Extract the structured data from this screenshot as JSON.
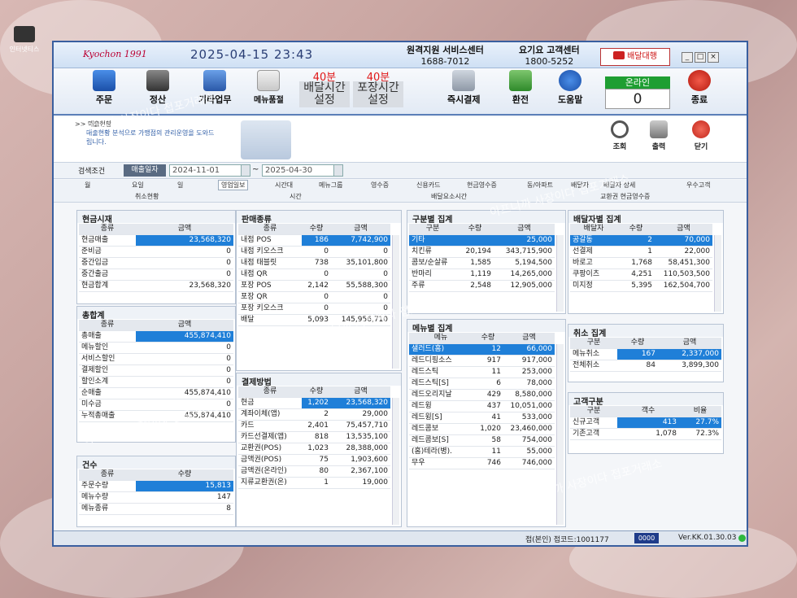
{
  "desktop": {
    "icon_label": "인터넷티스"
  },
  "header": {
    "logo": "Kyochon 1991",
    "datetime": "2025-04-15 23:43",
    "remote_support": {
      "label": "원격지원 서비스센터",
      "phone": "1688-7012"
    },
    "yogiyo": {
      "label": "요기요 고객센터",
      "phone": "1800-5252"
    },
    "delivery_button": "배달대행",
    "window_buttons": [
      "_",
      "□",
      "×"
    ]
  },
  "toolbar": {
    "order": "주문",
    "settlement": "정산",
    "other_work": "기타업무",
    "menu_soldout": "메뉴품절",
    "delivery_time": {
      "minutes": "40분",
      "label": "배달시간 설정"
    },
    "pack_time": {
      "minutes": "40분",
      "label": "포장시간 설정"
    },
    "instant_pay": "즉시결제",
    "exchange": "환전",
    "help": "도움말",
    "online": {
      "label": "온라인",
      "value": "0"
    },
    "exit": "종료"
  },
  "report": {
    "crumb": ">> 매출현황",
    "desc": "매출현황 분석으로 가맹점의 관리운영을 도와드립니다.",
    "view": "조회",
    "print": "출력",
    "close": "닫기"
  },
  "search": {
    "label": "검색조건",
    "date_type": "매출일자",
    "from": "2024-11-01",
    "tilde": "~",
    "to": "2025-04-30"
  },
  "tabs_row1": [
    "월",
    "요일",
    "일",
    "영업일보",
    "시간대",
    "메뉴그룹",
    "영수증",
    "신용카드",
    "현금영수증",
    "동/아파트",
    "배달자",
    "배달자 상세",
    "우수고객"
  ],
  "tabs_row2": [
    "취소현황",
    "시간",
    "배달요소시간",
    "교환권 현금영수증"
  ],
  "panels": {
    "cash": {
      "title": "현금시재",
      "headers": [
        "종류",
        "금액"
      ],
      "rows": [
        [
          "현금매출",
          "23,568,320"
        ],
        [
          "준비금",
          "0"
        ],
        [
          "중간입금",
          "0"
        ],
        [
          "중간출금",
          "0"
        ],
        [
          "현금합계",
          "23,568,320"
        ]
      ]
    },
    "total": {
      "title": "총합계",
      "headers": [
        "종류",
        "금액"
      ],
      "rows": [
        [
          "총매출",
          "455,874,410"
        ],
        [
          "메뉴할인",
          "0"
        ],
        [
          "서비스할인",
          "0"
        ],
        [
          "결제할인",
          "0"
        ],
        [
          "할인소계",
          "0"
        ],
        [
          "순매출",
          "455,874,410"
        ],
        [
          "미수금",
          "0"
        ],
        [
          "누적총매출",
          "455,874,410"
        ]
      ]
    },
    "count": {
      "title": "건수",
      "headers": [
        "종류",
        "수량"
      ],
      "rows": [
        [
          "주문수량",
          "15,813"
        ],
        [
          "메뉴수량",
          "147"
        ],
        [
          "메뉴종류",
          "8"
        ]
      ]
    },
    "sales_type": {
      "title": "판매종류",
      "headers": [
        "종류",
        "수량",
        "금액"
      ],
      "rows": [
        [
          "내점 POS",
          "186",
          "7,742,900"
        ],
        [
          "내점 키오스크",
          "0",
          "0"
        ],
        [
          "내점 태블릿",
          "738",
          "35,101,800"
        ],
        [
          "내점 QR",
          "0",
          "0"
        ],
        [
          "포장 POS",
          "2,142",
          "55,588,300"
        ],
        [
          "포장 QR",
          "0",
          "0"
        ],
        [
          "포장 키오스크",
          "0",
          "0"
        ],
        [
          "배달",
          "5,093",
          "145,956,710"
        ]
      ]
    },
    "payment": {
      "title": "결제방법",
      "headers": [
        "종류",
        "수량",
        "금액"
      ],
      "rows": [
        [
          "현금",
          "1,202",
          "23,568,320"
        ],
        [
          "계좌이체(앱)",
          "2",
          "29,000"
        ],
        [
          "카드",
          "2,401",
          "75,457,710"
        ],
        [
          "카드선결제(앱)",
          "818",
          "13,535,100"
        ],
        [
          "교환권(POS)",
          "1,023",
          "28,388,000"
        ],
        [
          "금액권(POS)",
          "75",
          "1,903,600"
        ],
        [
          "금액권(온라인)",
          "80",
          "2,367,100"
        ],
        [
          "지류교환권(온)",
          "1",
          "19,000"
        ]
      ]
    },
    "category": {
      "title": "구분별 집계",
      "headers": [
        "구분",
        "수량",
        "금액"
      ],
      "rows": [
        [
          "기타",
          "",
          "25,000"
        ],
        [
          "치킨류",
          "20,194",
          "343,715,900"
        ],
        [
          "콤보/순살류",
          "1,585",
          "5,194,500"
        ],
        [
          "반마리",
          "1,119",
          "14,265,000"
        ],
        [
          "주류",
          "2,548",
          "12,905,000"
        ]
      ]
    },
    "menu": {
      "title": "메뉴별 집계",
      "headers": [
        "메뉴",
        "수량",
        "금액"
      ],
      "rows": [
        [
          "샐러드(홈)",
          "12",
          "66,000"
        ],
        [
          "레드디핑소스",
          "917",
          "917,000"
        ],
        [
          "레드스틱",
          "11",
          "253,000"
        ],
        [
          "레드스틱[S]",
          "6",
          "78,000"
        ],
        [
          "레드오리지날",
          "429",
          "8,580,000"
        ],
        [
          "레드윙",
          "437",
          "10,051,000"
        ],
        [
          "레드윙[S]",
          "41",
          "533,000"
        ],
        [
          "레드콤보",
          "1,020",
          "23,460,000"
        ],
        [
          "레드콤보[S]",
          "58",
          "754,000"
        ],
        [
          "(홈)테라(병).",
          "11",
          "55,000"
        ],
        [
          "무우",
          "746",
          "746,000"
        ]
      ]
    },
    "driver": {
      "title": "배달자별 집계",
      "headers": [
        "배달자",
        "수량",
        "금액"
      ],
      "rows": [
        [
          "공갈동",
          "2",
          "70,000"
        ],
        [
          "선결제",
          "1",
          "22,000"
        ],
        [
          "바로고",
          "1,768",
          "58,451,300"
        ],
        [
          "쿠팡이츠",
          "4,251",
          "110,503,500"
        ],
        [
          "미지정",
          "5,395",
          "162,504,700"
        ]
      ]
    },
    "cancel": {
      "title": "취소 집계",
      "headers": [
        "구분",
        "수량",
        "금액"
      ],
      "rows": [
        [
          "메뉴취소",
          "167",
          "2,337,000"
        ],
        [
          "전체취소",
          "84",
          "3,899,300"
        ]
      ]
    },
    "customer": {
      "title": "고객구분",
      "headers": [
        "구분",
        "객수",
        "비율"
      ],
      "rows": [
        [
          "신규고객",
          "413",
          "27.7%"
        ],
        [
          "기존고객",
          "1,078",
          "72.3%"
        ]
      ]
    }
  },
  "status": {
    "terminal": "접(본인) 접코드:1001177",
    "code": "0000",
    "version": "Ver.KK.01.30.03"
  },
  "watermark": "아프니까 사장이다 접포거래소",
  "colors": {
    "highlight": "#1f7fd8",
    "accent_red": "#e01818",
    "online_green": "#1e9e32",
    "frame_blue": "#3a5f9f"
  }
}
